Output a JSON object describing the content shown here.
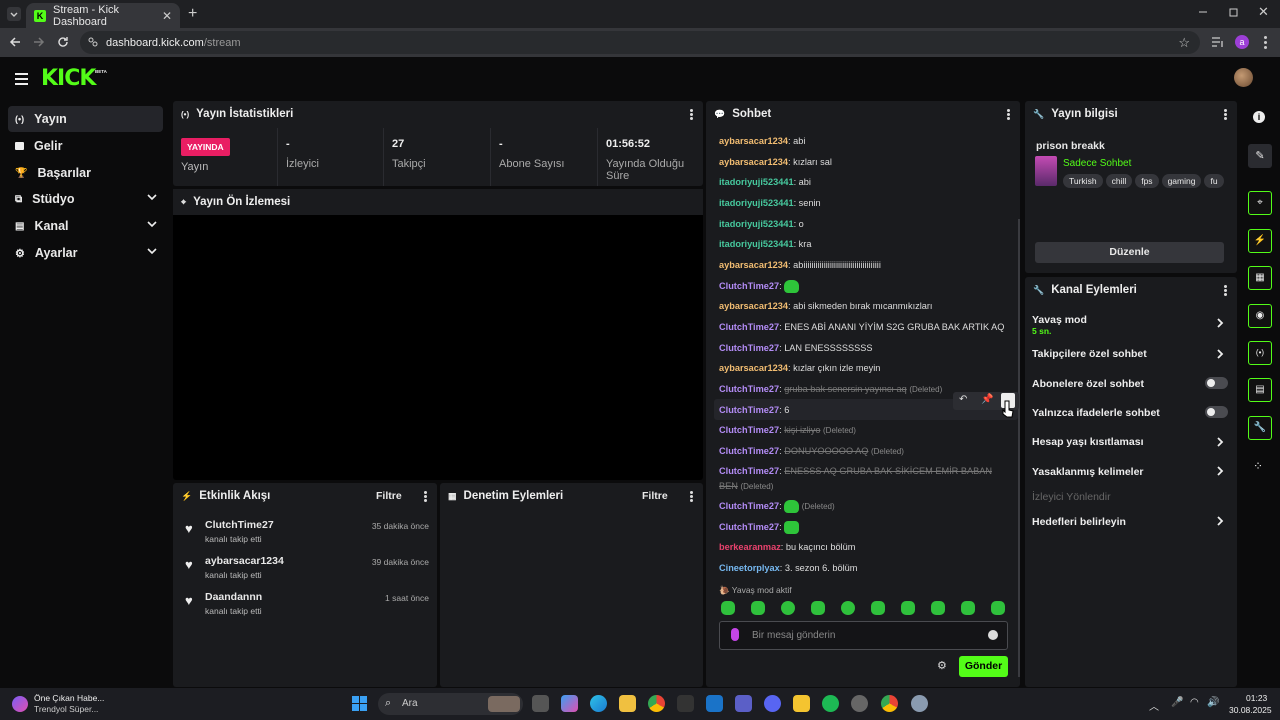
{
  "browser": {
    "tab_title": "Stream - Kick Dashboard",
    "url_domain": "dashboard.kick.com",
    "url_path": "/stream",
    "profile_initial": "a"
  },
  "header": {
    "logo": "KICK",
    "beta": "BETA"
  },
  "sidebar": {
    "items": [
      {
        "label": "Yayın",
        "icon": "broadcast-icon"
      },
      {
        "label": "Gelir",
        "icon": "income-icon"
      },
      {
        "label": "Başarılar",
        "icon": "trophy-icon"
      },
      {
        "label": "Stüdyo",
        "icon": "studio-icon"
      },
      {
        "label": "Kanal",
        "icon": "channel-icon"
      },
      {
        "label": "Ayarlar",
        "icon": "gear-icon"
      }
    ]
  },
  "stats_panel": {
    "title": "Yayın İstatistikleri",
    "live_badge": "YAYINDA",
    "live_label": "Yayın",
    "viewers_value": "-",
    "viewers_label": "İzleyici",
    "followers_value": "27",
    "followers_label": "Takipçi",
    "subs_value": "-",
    "subs_label": "Abone Sayısı",
    "uptime_value": "01:56:52",
    "uptime_label": "Yayında Olduğu Süre"
  },
  "preview_panel": {
    "title": "Yayın Ön İzlemesi"
  },
  "activity_panel": {
    "title": "Etkinlik Akışı",
    "filter": "Filtre",
    "items": [
      {
        "user": "ClutchTime27",
        "action": "kanalı takip etti",
        "time": "35 dakika önce"
      },
      {
        "user": "aybarsacar1234",
        "action": "kanalı takip etti",
        "time": "39 dakika önce"
      },
      {
        "user": "Daandannn",
        "action": "kanalı takip etti",
        "time": "1 saat önce"
      }
    ]
  },
  "moderation_panel": {
    "title": "Denetim Eylemleri",
    "filter": "Filtre"
  },
  "chat": {
    "title": "Sohbet",
    "slow_mode": "Yavaş mod aktif",
    "input_placeholder": "Bir mesaj gönderin",
    "send": "Gönder",
    "deleted_tag": "(Deleted)",
    "messages": [
      {
        "user": "aybarsacar1234",
        "text": "abi"
      },
      {
        "user": "aybarsacar1234",
        "text": "kızları sal"
      },
      {
        "user": "itadoriyuji523441",
        "text": "abi"
      },
      {
        "user": "itadoriyuji523441",
        "text": "senin"
      },
      {
        "user": "itadoriyuji523441",
        "text": "o"
      },
      {
        "user": "itadoriyuji523441",
        "text": "kra"
      },
      {
        "user": "aybarsacar1234",
        "text": "abiiiiiiiiiiiiiiiiiiiiiiiiiiiiiiiiiiiiii"
      },
      {
        "user": "ClutchTime27",
        "text": ""
      },
      {
        "user": "aybarsacar1234",
        "text": "abi sikmeden bırak mıcanmıkızları"
      },
      {
        "user": "ClutchTime27",
        "text": "ENES ABİ ANANI YİYİM S2G GRUBA BAK ARTIK AQ"
      },
      {
        "user": "ClutchTime27",
        "text": "LAN ENESSSSSSSS"
      },
      {
        "user": "aybarsacar1234",
        "text": "kızlar çıkın izle meyin"
      },
      {
        "user": "ClutchTime27",
        "text": "gruba bak senersin yayıncı aq"
      },
      {
        "user": "ClutchTime27",
        "text": "6"
      },
      {
        "user": "ClutchTime27",
        "text": "kişi izliyo"
      },
      {
        "user": "ClutchTime27",
        "text": "DONUYOOOOO AQ"
      },
      {
        "user": "ClutchTime27",
        "text": "ENESSS AQ GRUBA BAK SİKİCEM EMİR BABAN"
      },
      {
        "user": "",
        "text": "BEN"
      },
      {
        "user": "ClutchTime27",
        "text": ""
      },
      {
        "user": "ClutchTime27",
        "text": ""
      },
      {
        "user": "berkearanmaz",
        "text": "bu kaçıncı bölüm"
      },
      {
        "user": "Cineetorplyax",
        "text": "3. sezon 6. bölüm"
      }
    ]
  },
  "stream_info": {
    "title": "Yayın bilgisi",
    "stream_title": "prison breakk",
    "category": "Sadece Sohbet",
    "tags": [
      "Turkish",
      "chill",
      "fps",
      "gaming",
      "fu"
    ],
    "edit": "Düzenle"
  },
  "channel_actions": {
    "title": "Kanal Eylemleri",
    "slow_mode": "Yavaş mod",
    "slow_mode_value": "5 sn.",
    "followers_only": "Takipçilere özel sohbet",
    "subs_only": "Abonelere özel sohbet",
    "emotes_only": "Yalnızca ifadelerle sohbet",
    "account_age": "Hesap yaşı kısıtlaması",
    "banned_words": "Yasaklanmış kelimeler",
    "redirect": "İzleyici Yönlendir",
    "goals": "Hedefleri belirleyin"
  },
  "taskbar": {
    "news_title": "Öne Çıkan Habe...",
    "news_sub": "Trendyol Süper...",
    "search": "Ara",
    "time": "01:23",
    "date": "30.08.2025"
  },
  "colors": {
    "kick_green": "#53fc18",
    "live_red": "#e91e63",
    "panel": "#1a1b1e"
  }
}
